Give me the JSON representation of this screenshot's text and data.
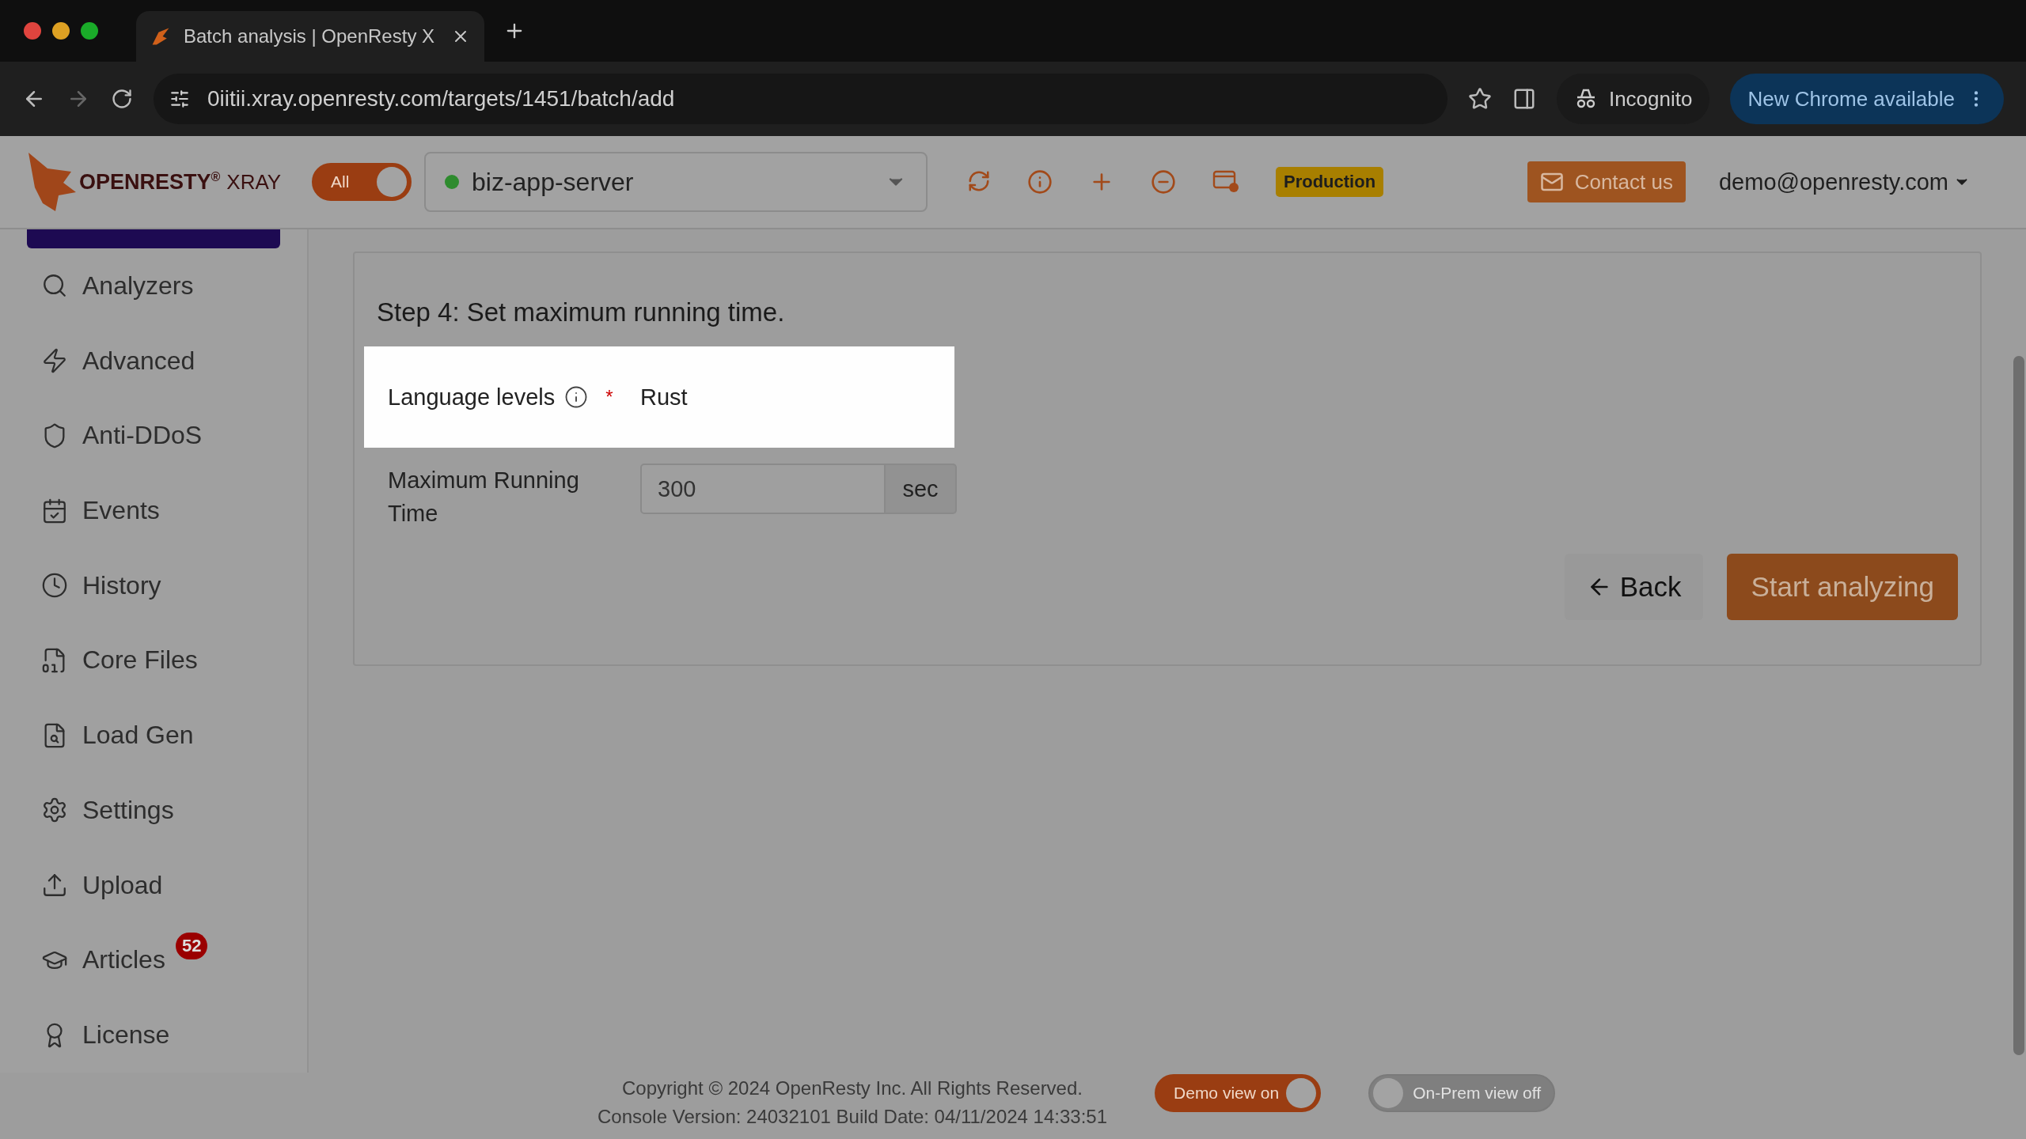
{
  "browser": {
    "tab_title": "Batch analysis | OpenResty X",
    "url": "0iitii.xray.openresty.com/targets/1451/batch/add",
    "profile": "Incognito",
    "update_button": "New Chrome available"
  },
  "header": {
    "logo": {
      "wordmark": "OPENRESTY",
      "registered": "®",
      "product": "XRAY"
    },
    "scope_toggle": {
      "label": "All",
      "on": true
    },
    "target": {
      "name": "biz-app-server",
      "color": "#2e8b2e"
    },
    "environment_badge": "Production",
    "contact_button": "Contact us",
    "user_menu": "demo@openresty.com"
  },
  "sidebar": {
    "items": [
      {
        "label": "Analyzers"
      },
      {
        "label": "Advanced"
      },
      {
        "label": "Anti-DDoS"
      },
      {
        "label": "Events"
      },
      {
        "label": "History"
      },
      {
        "label": "Core Files"
      },
      {
        "label": "Load Gen"
      },
      {
        "label": "Settings"
      },
      {
        "label": "Upload"
      },
      {
        "label": "Articles",
        "badge": "52"
      },
      {
        "label": "License"
      }
    ]
  },
  "form": {
    "step_title": "Step 4: Set maximum running time.",
    "language_row": {
      "label": "Language levels",
      "required_mark": "*",
      "value": "Rust",
      "highlighted": true
    },
    "running_time": {
      "label": "Maximum Running Time",
      "value": "300",
      "unit": "sec"
    },
    "back_button": "Back",
    "start_button": "Start analyzing"
  },
  "footer": {
    "copyright": "Copyright © 2024 OpenResty Inc. All Rights Reserved.",
    "version": "Console Version: 24032101 Build Date: 04/11/2024 14:33:51",
    "toggles": [
      {
        "label": "Demo view on",
        "on": true
      },
      {
        "label": "On-Prem view off",
        "on": false
      }
    ]
  }
}
